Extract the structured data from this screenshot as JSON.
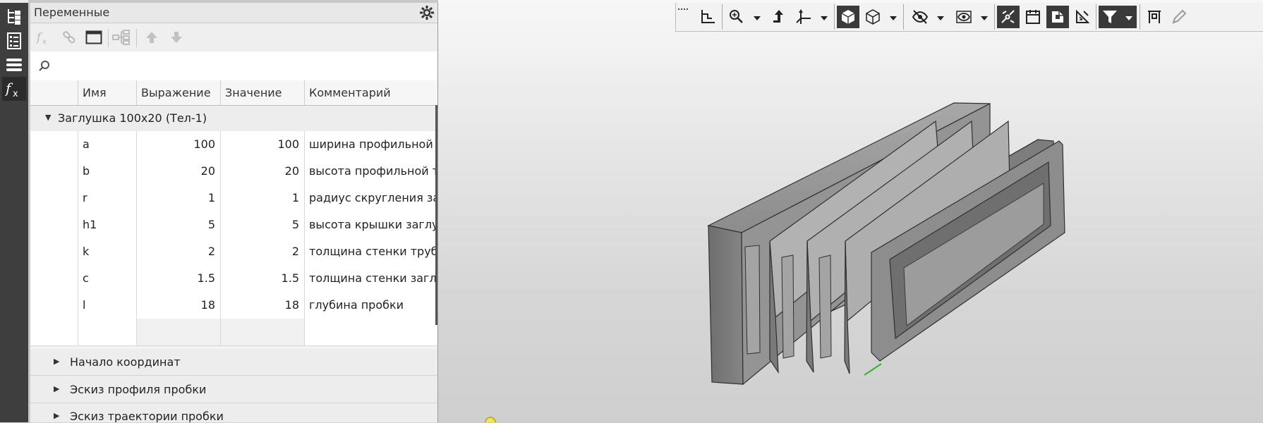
{
  "left_strip": {
    "items": [
      {
        "icon": "model-tree-icon"
      },
      {
        "icon": "properties-icon"
      },
      {
        "icon": "layers-icon"
      },
      {
        "icon": "variables-fx-icon",
        "active": true
      }
    ]
  },
  "panel": {
    "title": "Переменные",
    "toolbar": [
      {
        "icon": "fx-icon"
      },
      {
        "icon": "link-icon"
      },
      {
        "icon": "window-icon"
      },
      {
        "icon": "tree-structure-icon"
      },
      {
        "icon": "arrow-up-icon"
      },
      {
        "icon": "arrow-down-icon"
      }
    ],
    "search": {
      "placeholder": "",
      "value": ""
    },
    "columns": [
      "Имя",
      "Выражение",
      "Значение",
      "Комментарий"
    ],
    "group": "Заглушка 100х20 (Тел-1)",
    "rows": [
      {
        "name": "a",
        "expression": "100",
        "value": "100",
        "comment": "ширина профильной"
      },
      {
        "name": "b",
        "expression": "20",
        "value": "20",
        "comment": "высота профильной т"
      },
      {
        "name": "r",
        "expression": "1",
        "value": "1",
        "comment": "радиус скругления за"
      },
      {
        "name": "h1",
        "expression": "5",
        "value": "5",
        "comment": "высота крышки заглу"
      },
      {
        "name": "k",
        "expression": "2",
        "value": "2",
        "comment": "толщина стенки трубы"
      },
      {
        "name": "c",
        "expression": "1.5",
        "value": "1.5",
        "comment": "толщина стенки заглу"
      },
      {
        "name": "l",
        "expression": "18",
        "value": "18",
        "comment": "глубина пробки"
      }
    ],
    "sub_groups": [
      "Начало координат",
      "Эскиз  профиля пробки",
      "Эскиз  траектории пробки"
    ]
  },
  "viewport_toolbar": [
    {
      "icon": "orientation-icon"
    },
    {
      "icon": "zoom-icon"
    },
    {
      "icon": "rotate-icon"
    },
    {
      "icon": "axes-icon"
    },
    {
      "icon": "shaded-display-icon",
      "active": true
    },
    {
      "icon": "wireframe-display-icon"
    },
    {
      "icon": "hide-icon"
    },
    {
      "icon": "show-icon"
    },
    {
      "icon": "constraints-icon",
      "active": true
    },
    {
      "icon": "calendar-icon"
    },
    {
      "icon": "material-icon",
      "active": true
    },
    {
      "icon": "section-icon"
    },
    {
      "icon": "filter-icon",
      "active": true
    },
    {
      "icon": "measure-icon"
    },
    {
      "icon": "pencil-icon"
    }
  ],
  "colors": {
    "accent_dark": "#3a3a3a",
    "model_gray": "#8a8a8a",
    "origin_green": "#2db82d"
  }
}
